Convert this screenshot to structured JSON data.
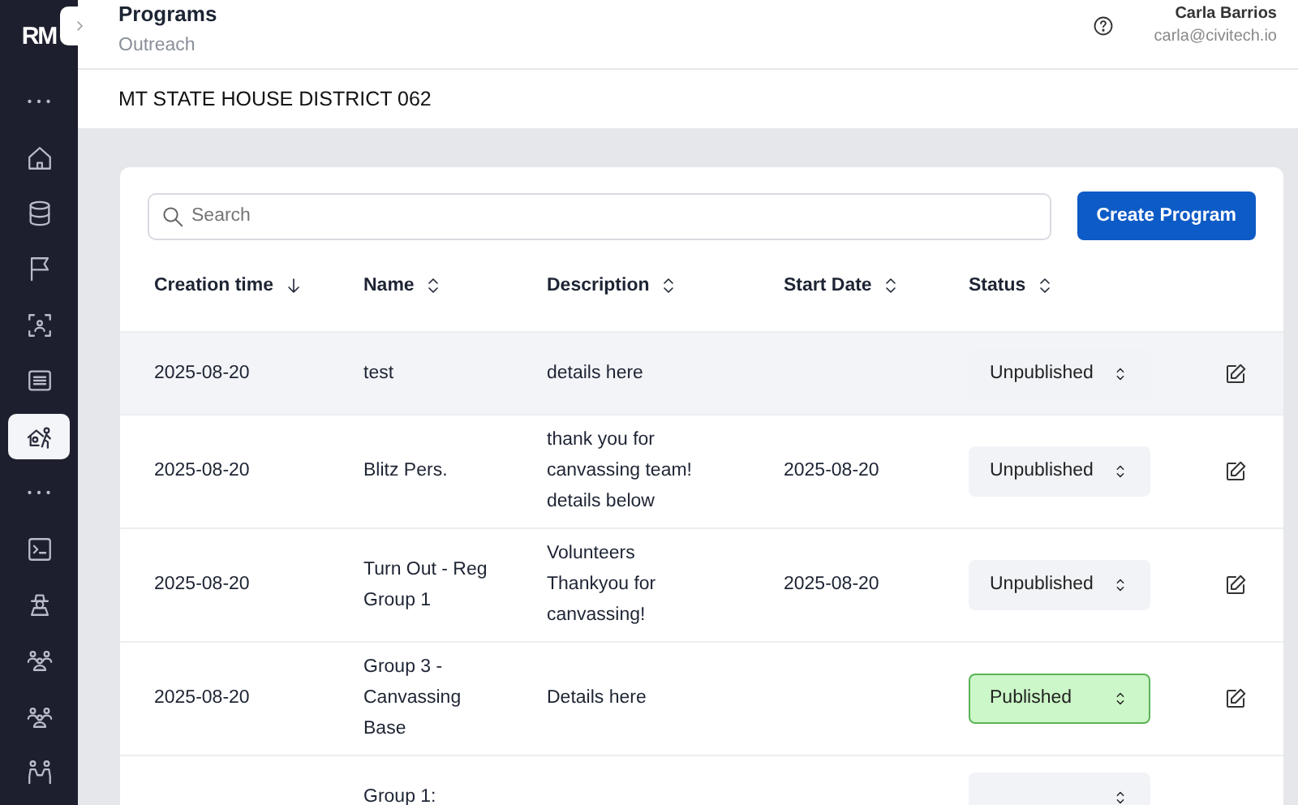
{
  "sidebar": {
    "logo": "RM",
    "items": [
      {
        "kind": "more",
        "selected": false
      },
      {
        "kind": "home",
        "selected": false
      },
      {
        "kind": "database",
        "selected": false
      },
      {
        "kind": "flag",
        "selected": false
      },
      {
        "kind": "people-scan",
        "selected": false
      },
      {
        "kind": "list",
        "selected": false
      },
      {
        "kind": "house-person",
        "selected": true
      },
      {
        "kind": "more",
        "selected": false
      },
      {
        "kind": "terminal",
        "selected": false
      },
      {
        "kind": "agent",
        "selected": false
      },
      {
        "kind": "group",
        "selected": false
      },
      {
        "kind": "group",
        "selected": false
      },
      {
        "kind": "pair",
        "selected": false
      }
    ]
  },
  "header": {
    "title": "Programs",
    "subtitle": "Outreach",
    "user": {
      "name": "Carla Barrios",
      "email": "carla@civitech.io"
    }
  },
  "subheader": {
    "title": "MT STATE HOUSE DISTRICT 062"
  },
  "search": {
    "placeholder": "Search"
  },
  "create_button": "Create Program",
  "table": {
    "columns": [
      {
        "label": "Creation time",
        "sorted": true
      },
      {
        "label": "Name",
        "sorted": false
      },
      {
        "label": "Description",
        "sorted": false
      },
      {
        "label": "Start Date",
        "sorted": false
      },
      {
        "label": "Status",
        "sorted": false
      }
    ],
    "rows": [
      {
        "highlighted": true,
        "creation_time": "2025-08-20",
        "name": "test",
        "description": "details here",
        "start_date": "",
        "status": {
          "label": "Unpublished",
          "published": false
        }
      },
      {
        "highlighted": false,
        "creation_time": "2025-08-20",
        "name": "Blitz Pers.",
        "description": "thank you for canvassing team! details below",
        "start_date": "2025-08-20",
        "status": {
          "label": "Unpublished",
          "published": false
        }
      },
      {
        "highlighted": false,
        "creation_time": "2025-08-20",
        "name": "Turn Out - Reg Group 1",
        "description": "Volunteers Thankyou for canvassing!",
        "start_date": "2025-08-20",
        "status": {
          "label": "Unpublished",
          "published": false
        }
      },
      {
        "highlighted": false,
        "creation_time": "2025-08-20",
        "name": "Group 3 - Canvassing Base",
        "description": "Details here",
        "start_date": "",
        "status": {
          "label": "Published",
          "published": true
        }
      },
      {
        "highlighted": false,
        "creation_time": "",
        "name": "Group 1:",
        "description": "",
        "start_date": "",
        "status": {
          "published": false
        }
      }
    ]
  }
}
